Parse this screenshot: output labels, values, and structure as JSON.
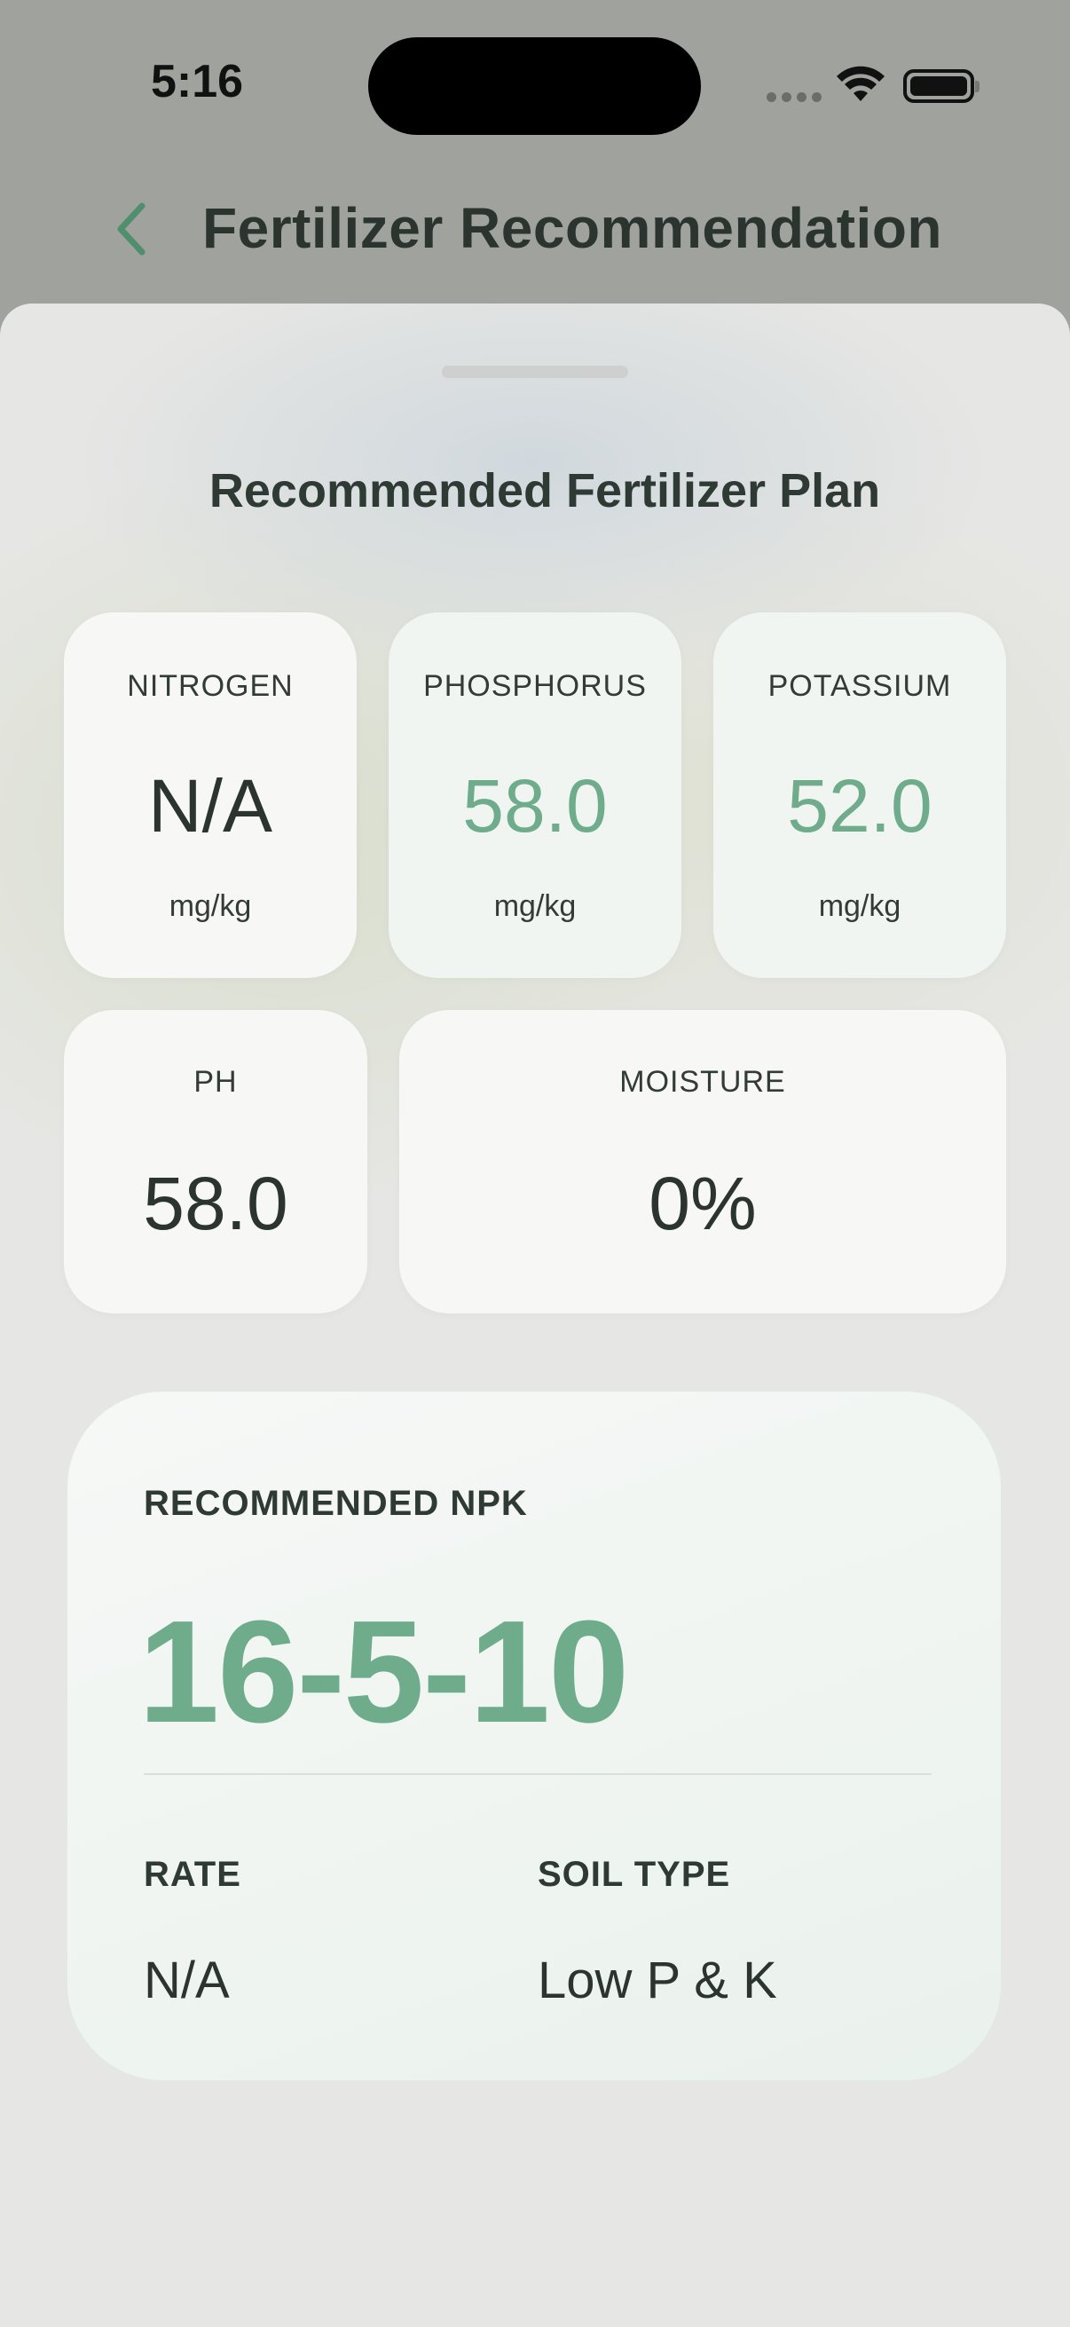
{
  "status_bar": {
    "time": "5:16"
  },
  "nav": {
    "back_icon": "chevron-left-icon",
    "title": "Fertilizer Recommendation"
  },
  "sheet": {
    "title": "Recommended Fertilizer Plan"
  },
  "nutrients": [
    {
      "label": "NITROGEN",
      "value": "N/A",
      "unit": "mg/kg"
    },
    {
      "label": "PHOSPHORUS",
      "value": "58.0",
      "unit": "mg/kg"
    },
    {
      "label": "POTASSIUM",
      "value": "52.0",
      "unit": "mg/kg"
    }
  ],
  "ph": {
    "label": "PH",
    "value": "58.0"
  },
  "moisture": {
    "label": "MOISTURE",
    "value": "0%"
  },
  "recommendation": {
    "npk_label": "RECOMMENDED NPK",
    "npk_value": "16-5-10",
    "rate_label": "RATE",
    "rate_value": "N/A",
    "soil_label": "SOIL TYPE",
    "soil_value": "Low P & K"
  },
  "colors": {
    "accent_green": "#6fac8c",
    "text_dark": "#2b342f",
    "backdrop": "#a0a29d"
  }
}
